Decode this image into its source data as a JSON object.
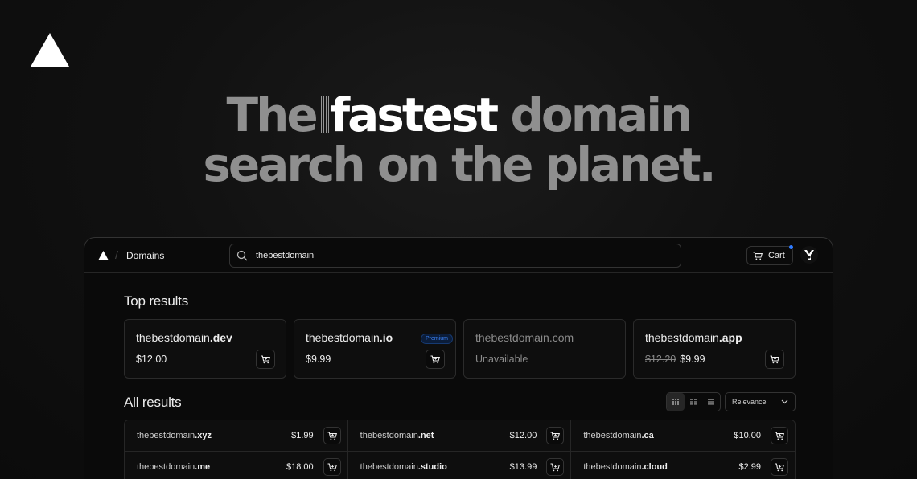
{
  "hero": {
    "line1_pre": "The",
    "line1_strong": "fastest",
    "line1_post": "domain",
    "line2": "search on the planet."
  },
  "app": {
    "title": "Domains",
    "search": {
      "value": "thebestdomain|",
      "placeholder": ""
    },
    "cart_label": "Cart"
  },
  "top_results": {
    "title": "Top results",
    "cards": [
      {
        "name": "thebestdomain",
        "tld": ".dev",
        "price": "$12.00",
        "old_price": "",
        "badge": "",
        "available": true
      },
      {
        "name": "thebestdomain",
        "tld": ".io",
        "price": "$9.99",
        "old_price": "",
        "badge": "Premium",
        "available": true
      },
      {
        "name": "thebestdomain",
        "tld": ".com",
        "price": "Unavailable",
        "old_price": "",
        "badge": "",
        "available": false
      },
      {
        "name": "thebestdomain",
        "tld": ".app",
        "price": "$9.99",
        "old_price": "$12.20",
        "badge": "",
        "available": true
      }
    ]
  },
  "all_results": {
    "title": "All results",
    "sort": "Relevance",
    "rows": [
      {
        "name": "thebestdomain",
        "tld": ".xyz",
        "price": "$1.99"
      },
      {
        "name": "thebestdomain",
        "tld": ".net",
        "price": "$12.00"
      },
      {
        "name": "thebestdomain",
        "tld": ".ca",
        "price": "$10.00"
      },
      {
        "name": "thebestdomain",
        "tld": ".me",
        "price": "$18.00"
      },
      {
        "name": "thebestdomain",
        "tld": ".studio",
        "price": "$13.99"
      },
      {
        "name": "thebestdomain",
        "tld": ".cloud",
        "price": "$2.99"
      }
    ]
  },
  "colors": {
    "background": "#0d0d0d",
    "accent": "#2f7bff",
    "premium": "#3b82f6"
  },
  "icons": [
    "triangle-logo-icon",
    "search-icon",
    "cart-icon",
    "grid-view-icon",
    "compact-grid-icon",
    "list-view-icon",
    "chevron-down-icon",
    "avatar-icon"
  ]
}
